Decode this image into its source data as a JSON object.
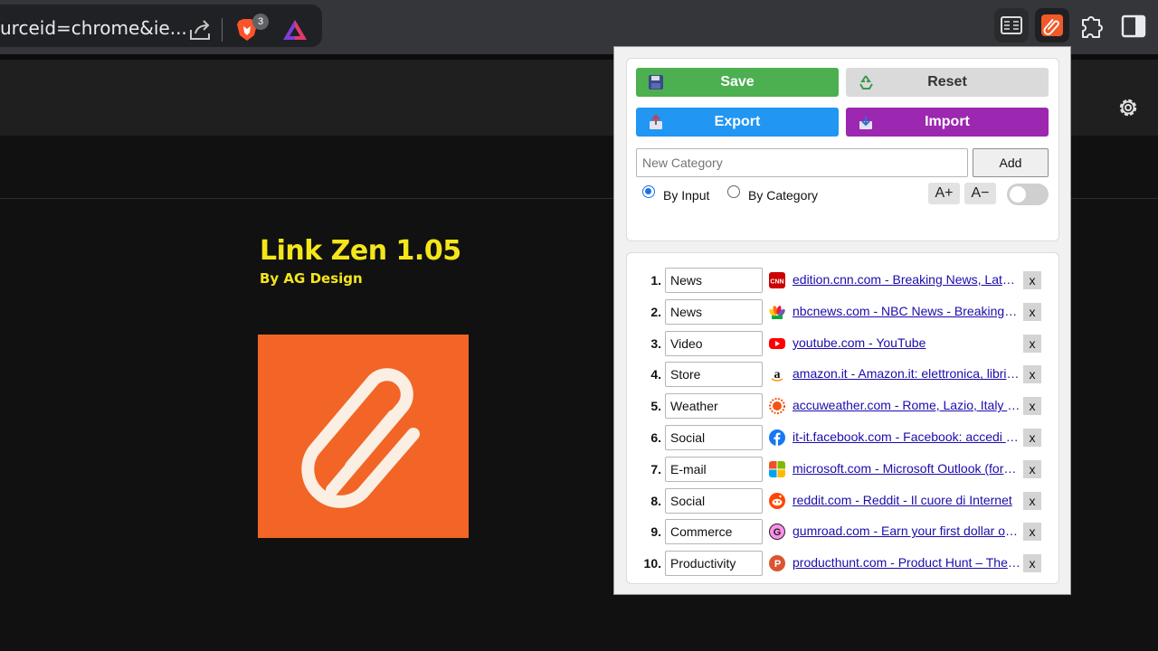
{
  "browser": {
    "url_fragment": "urceid=chrome&ie...",
    "brave_badge_count": "3"
  },
  "app": {
    "title": "Link Zen 1.05",
    "subtitle": "By AG Design"
  },
  "popup": {
    "buttons": {
      "save": "Save",
      "reset": "Reset",
      "export": "Export",
      "import": "Import",
      "add": "Add"
    },
    "category_input": {
      "placeholder": "New Category",
      "value": ""
    },
    "sort_options": [
      {
        "label": "By Input",
        "selected": true
      },
      {
        "label": "By Category",
        "selected": false
      }
    ],
    "font_increase": "A+",
    "font_decrease": "A−",
    "toggle_on": false,
    "remove_label": "x",
    "links": [
      {
        "num": "1.",
        "category": "News",
        "favicon": "cnn-icon",
        "text": "edition.cnn.com - Breaking News, Latest News and Videos | CNN"
      },
      {
        "num": "2.",
        "category": "News",
        "favicon": "nbc-peacock-icon",
        "text": "nbcnews.com - NBC News - Breaking News & Top Stories"
      },
      {
        "num": "3.",
        "category": "Video",
        "favicon": "youtube-icon",
        "text": "youtube.com - YouTube"
      },
      {
        "num": "4.",
        "category": "Store",
        "favicon": "amazon-icon",
        "text": "amazon.it - Amazon.it: elettronica, libri, musica, fashion"
      },
      {
        "num": "5.",
        "category": "Weather",
        "favicon": "accuweather-sun-icon",
        "text": "accuweather.com - Rome, Lazio, Italy Weather"
      },
      {
        "num": "6.",
        "category": "Social",
        "favicon": "facebook-icon",
        "text": "it-it.facebook.com - Facebook: accedi o iscriviti"
      },
      {
        "num": "7.",
        "category": "E-mail",
        "favicon": "microsoft-icon",
        "text": "microsoft.com - Microsoft Outlook (formerly Hotmail)"
      },
      {
        "num": "8.",
        "category": "Social",
        "favicon": "reddit-icon",
        "text": "reddit.com - Reddit - Il cuore di Internet"
      },
      {
        "num": "9.",
        "category": "Commerce",
        "favicon": "gumroad-icon",
        "text": "gumroad.com - Earn your first dollar online"
      },
      {
        "num": "10.",
        "category": "Productivity",
        "favicon": "producthunt-icon",
        "text": "producthunt.com - Product Hunt – The best new products"
      }
    ]
  },
  "colors": {
    "save": "#4caf50",
    "export": "#2196f3",
    "import": "#9c27b0",
    "title": "#f4e61a",
    "logo_bg": "#f26526",
    "link": "#1a0dab"
  }
}
